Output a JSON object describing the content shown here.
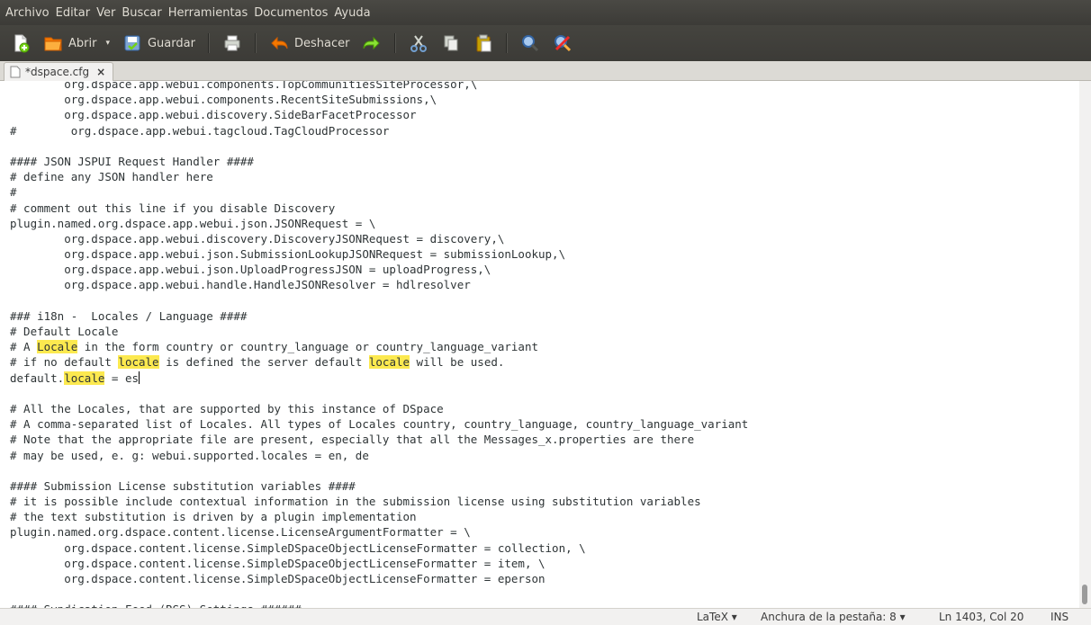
{
  "menubar": {
    "items": [
      "Archivo",
      "Editar",
      "Ver",
      "Buscar",
      "Herramientas",
      "Documentos",
      "Ayuda"
    ]
  },
  "toolbar": {
    "open_label": "Abrir",
    "save_label": "Guardar",
    "undo_label": "Deshacer"
  },
  "tab": {
    "title": "*dspace.cfg",
    "close": "×"
  },
  "editor": {
    "lines": [
      "        org.dspace.app.webui.components.TopCommunitiesSiteProcessor,\\",
      "        org.dspace.app.webui.components.RecentSiteSubmissions,\\",
      "        org.dspace.app.webui.discovery.SideBarFacetProcessor",
      "#        org.dspace.app.webui.tagcloud.TagCloudProcessor",
      "",
      "#### JSON JSPUI Request Handler ####",
      "# define any JSON handler here",
      "#",
      "# comment out this line if you disable Discovery",
      "plugin.named.org.dspace.app.webui.json.JSONRequest = \\",
      "        org.dspace.app.webui.discovery.DiscoveryJSONRequest = discovery,\\",
      "        org.dspace.app.webui.json.SubmissionLookupJSONRequest = submissionLookup,\\",
      "        org.dspace.app.webui.json.UploadProgressJSON = uploadProgress,\\",
      "        org.dspace.app.webui.handle.HandleJSONResolver = hdlresolver",
      "",
      "### i18n -  Locales / Language ####",
      "# Default Locale",
      "# A [[Locale]] in the form country or country_language or country_language_variant",
      "# if no default [[locale]] is defined the server default [[locale]] will be used.",
      "default.[[locale]] = es|",
      "",
      "# All the Locales, that are supported by this instance of DSpace",
      "# A comma-separated list of Locales. All types of Locales country, country_language, country_language_variant",
      "# Note that the appropriate file are present, especially that all the Messages_x.properties are there",
      "# may be used, e. g: webui.supported.locales = en, de",
      "",
      "#### Submission License substitution variables ####",
      "# it is possible include contextual information in the submission license using substitution variables",
      "# the text substitution is driven by a plugin implementation",
      "plugin.named.org.dspace.content.license.LicenseArgumentFormatter = \\",
      "        org.dspace.content.license.SimpleDSpaceObjectLicenseFormatter = collection, \\",
      "        org.dspace.content.license.SimpleDSpaceObjectLicenseFormatter = item, \\",
      "        org.dspace.content.license.SimpleDSpaceObjectLicenseFormatter = eperson",
      "",
      "#### Syndication Feed (RSS) Settings ######"
    ]
  },
  "statusbar": {
    "language": "LaTeX",
    "tab_width": "Anchura de la pestaña: 8",
    "position": "Ln 1403, Col 20",
    "mode": "INS"
  },
  "colors": {
    "highlight": "#fce94f",
    "menubar": "#3c3b37"
  }
}
